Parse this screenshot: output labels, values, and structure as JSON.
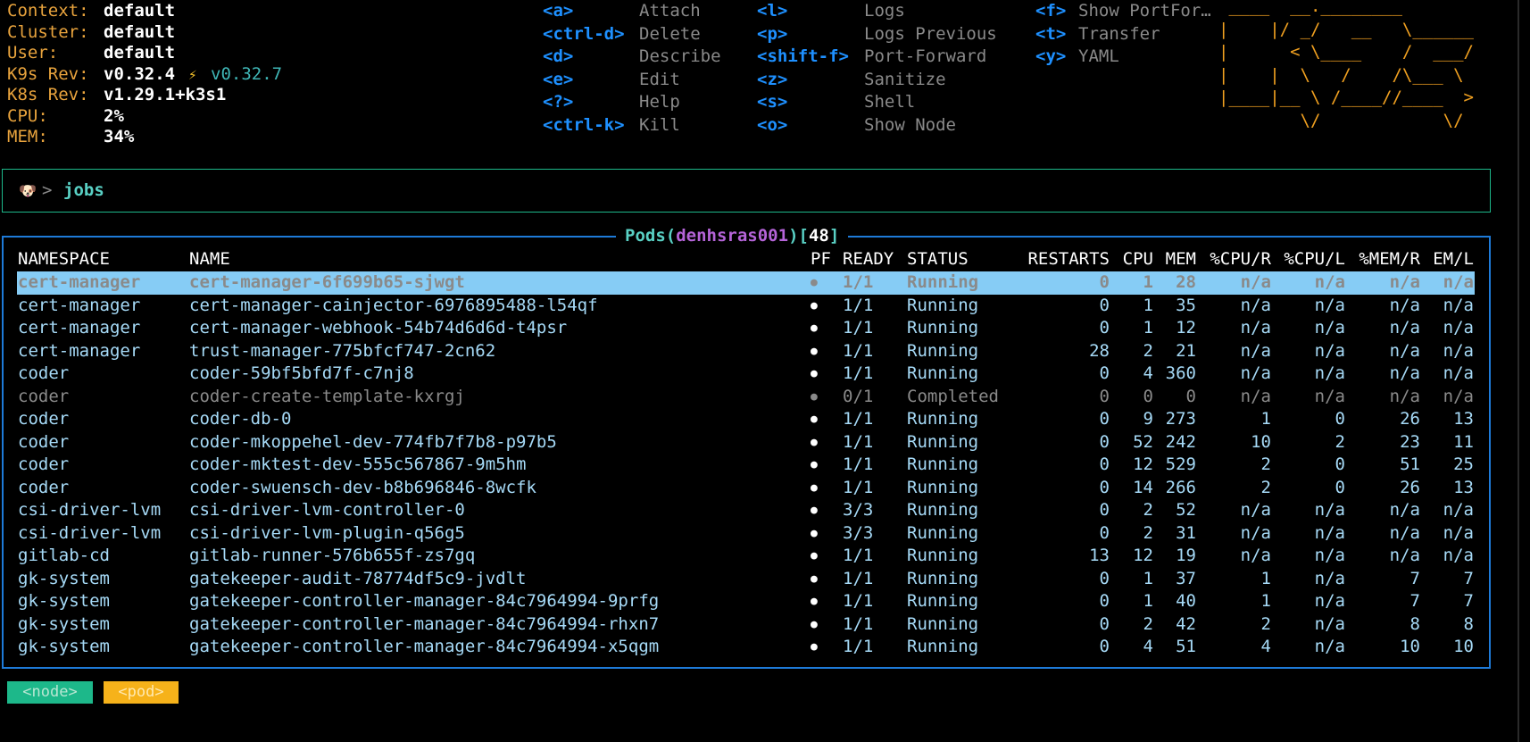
{
  "info": [
    {
      "label": "Context:",
      "value": "default"
    },
    {
      "label": "Cluster:",
      "value": "default"
    },
    {
      "label": "User:",
      "value": "default"
    },
    {
      "label": "K9s Rev:",
      "value": "v0.32.4",
      "update_icon": "⚡",
      "update": "v0.32.7"
    },
    {
      "label": "K8s Rev:",
      "value": "v1.29.1+k3s1"
    },
    {
      "label": "CPU:",
      "value": "2%"
    },
    {
      "label": "MEM:",
      "value": "34%"
    }
  ],
  "shortcuts": {
    "col1": [
      {
        "key": "<a>",
        "action": "Attach"
      },
      {
        "key": "<ctrl-d>",
        "action": "Delete"
      },
      {
        "key": "<d>",
        "action": "Describe"
      },
      {
        "key": "<e>",
        "action": "Edit"
      },
      {
        "key": "<?>",
        "action": "Help"
      },
      {
        "key": "<ctrl-k>",
        "action": "Kill"
      }
    ],
    "col2": [
      {
        "key": "<l>",
        "action": "Logs"
      },
      {
        "key": "<p>",
        "action": "Logs Previous"
      },
      {
        "key": "<shift-f>",
        "action": "Port-Forward"
      },
      {
        "key": "<z>",
        "action": "Sanitize"
      },
      {
        "key": "<s>",
        "action": "Shell"
      },
      {
        "key": "<o>",
        "action": "Show Node"
      }
    ],
    "col3": [
      {
        "key": "<f>",
        "action": "Show PortFor…"
      },
      {
        "key": "<t>",
        "action": "Transfer"
      },
      {
        "key": "<y>",
        "action": "YAML"
      }
    ]
  },
  "logo_lines": [
    " ____  __.________       ",
    "|    |/ _/   __   \\______",
    "|      < \\____    /  ___/",
    "|    |  \\   /    /\\___ \\ ",
    "|____|__ \\ /____//____  >",
    "        \\/            \\/ "
  ],
  "command": {
    "icon": "🐶",
    "prompt": ">",
    "text": "jobs"
  },
  "pods": {
    "title": "Pods",
    "context": "denhsras001",
    "count": "48",
    "headers": {
      "namespace": "NAMESPACE",
      "sort_arrow": "↑",
      "name": "NAME",
      "pf": "PF",
      "ready": "READY",
      "status": "STATUS",
      "restarts": "RESTARTS",
      "cpu": "CPU",
      "mem": "MEM",
      "cpu_r": "%CPU/R",
      "cpu_l": "%CPU/L",
      "mem_r": "%MEM/R",
      "mem_l": "EM/L"
    },
    "rows": [
      {
        "ns": "cert-manager",
        "name": "cert-manager-6f699b65-sjwgt",
        "pf": "●",
        "ready": "1/1",
        "status": "Running",
        "restarts": "0",
        "cpu": "1",
        "mem": "28",
        "cpu_r": "n/a",
        "cpu_l": "n/a",
        "mem_r": "n/a",
        "mem_l": "n/a",
        "selected": true
      },
      {
        "ns": "cert-manager",
        "name": "cert-manager-cainjector-6976895488-l54qf",
        "pf": "●",
        "ready": "1/1",
        "status": "Running",
        "restarts": "0",
        "cpu": "1",
        "mem": "35",
        "cpu_r": "n/a",
        "cpu_l": "n/a",
        "mem_r": "n/a",
        "mem_l": "n/a"
      },
      {
        "ns": "cert-manager",
        "name": "cert-manager-webhook-54b74d6d6d-t4psr",
        "pf": "●",
        "ready": "1/1",
        "status": "Running",
        "restarts": "0",
        "cpu": "1",
        "mem": "12",
        "cpu_r": "n/a",
        "cpu_l": "n/a",
        "mem_r": "n/a",
        "mem_l": "n/a"
      },
      {
        "ns": "cert-manager",
        "name": "trust-manager-775bfcf747-2cn62",
        "pf": "●",
        "ready": "1/1",
        "status": "Running",
        "restarts": "28",
        "cpu": "2",
        "mem": "21",
        "cpu_r": "n/a",
        "cpu_l": "n/a",
        "mem_r": "n/a",
        "mem_l": "n/a"
      },
      {
        "ns": "coder",
        "name": "coder-59bf5bfd7f-c7nj8",
        "pf": "●",
        "ready": "1/1",
        "status": "Running",
        "restarts": "0",
        "cpu": "4",
        "mem": "360",
        "cpu_r": "n/a",
        "cpu_l": "n/a",
        "mem_r": "n/a",
        "mem_l": "n/a"
      },
      {
        "ns": "coder",
        "name": "coder-create-template-kxrgj",
        "pf": "●",
        "ready": "0/1",
        "status": "Completed",
        "restarts": "0",
        "cpu": "0",
        "mem": "0",
        "cpu_r": "n/a",
        "cpu_l": "n/a",
        "mem_r": "n/a",
        "mem_l": "n/a",
        "dim": true
      },
      {
        "ns": "coder",
        "name": "coder-db-0",
        "pf": "●",
        "ready": "1/1",
        "status": "Running",
        "restarts": "0",
        "cpu": "9",
        "mem": "273",
        "cpu_r": "1",
        "cpu_l": "0",
        "mem_r": "26",
        "mem_l": "13"
      },
      {
        "ns": "coder",
        "name": "coder-mkoppehel-dev-774fb7f7b8-p97b5",
        "pf": "●",
        "ready": "1/1",
        "status": "Running",
        "restarts": "0",
        "cpu": "52",
        "mem": "242",
        "cpu_r": "10",
        "cpu_l": "2",
        "mem_r": "23",
        "mem_l": "11"
      },
      {
        "ns": "coder",
        "name": "coder-mktest-dev-555c567867-9m5hm",
        "pf": "●",
        "ready": "1/1",
        "status": "Running",
        "restarts": "0",
        "cpu": "12",
        "mem": "529",
        "cpu_r": "2",
        "cpu_l": "0",
        "mem_r": "51",
        "mem_l": "25"
      },
      {
        "ns": "coder",
        "name": "coder-swuensch-dev-b8b696846-8wcfk",
        "pf": "●",
        "ready": "1/1",
        "status": "Running",
        "restarts": "0",
        "cpu": "14",
        "mem": "266",
        "cpu_r": "2",
        "cpu_l": "0",
        "mem_r": "26",
        "mem_l": "13"
      },
      {
        "ns": "csi-driver-lvm",
        "name": "csi-driver-lvm-controller-0",
        "pf": "●",
        "ready": "3/3",
        "status": "Running",
        "restarts": "0",
        "cpu": "2",
        "mem": "52",
        "cpu_r": "n/a",
        "cpu_l": "n/a",
        "mem_r": "n/a",
        "mem_l": "n/a"
      },
      {
        "ns": "csi-driver-lvm",
        "name": "csi-driver-lvm-plugin-q56g5",
        "pf": "●",
        "ready": "3/3",
        "status": "Running",
        "restarts": "0",
        "cpu": "2",
        "mem": "31",
        "cpu_r": "n/a",
        "cpu_l": "n/a",
        "mem_r": "n/a",
        "mem_l": "n/a"
      },
      {
        "ns": "gitlab-cd",
        "name": "gitlab-runner-576b655f-zs7gq",
        "pf": "●",
        "ready": "1/1",
        "status": "Running",
        "restarts": "13",
        "cpu": "12",
        "mem": "19",
        "cpu_r": "n/a",
        "cpu_l": "n/a",
        "mem_r": "n/a",
        "mem_l": "n/a"
      },
      {
        "ns": "gk-system",
        "name": "gatekeeper-audit-78774df5c9-jvdlt",
        "pf": "●",
        "ready": "1/1",
        "status": "Running",
        "restarts": "0",
        "cpu": "1",
        "mem": "37",
        "cpu_r": "1",
        "cpu_l": "n/a",
        "mem_r": "7",
        "mem_l": "7"
      },
      {
        "ns": "gk-system",
        "name": "gatekeeper-controller-manager-84c7964994-9prfg",
        "pf": "●",
        "ready": "1/1",
        "status": "Running",
        "restarts": "0",
        "cpu": "1",
        "mem": "40",
        "cpu_r": "1",
        "cpu_l": "n/a",
        "mem_r": "7",
        "mem_l": "7"
      },
      {
        "ns": "gk-system",
        "name": "gatekeeper-controller-manager-84c7964994-rhxn7",
        "pf": "●",
        "ready": "1/1",
        "status": "Running",
        "restarts": "0",
        "cpu": "2",
        "mem": "42",
        "cpu_r": "2",
        "cpu_l": "n/a",
        "mem_r": "8",
        "mem_l": "8"
      },
      {
        "ns": "gk-system",
        "name": "gatekeeper-controller-manager-84c7964994-x5qgm",
        "pf": "●",
        "ready": "1/1",
        "status": "Running",
        "restarts": "0",
        "cpu": "4",
        "mem": "51",
        "cpu_r": "4",
        "cpu_l": "n/a",
        "mem_r": "10",
        "mem_l": "10"
      }
    ]
  },
  "breadcrumbs": {
    "node": "<node>",
    "pod": "<pod>"
  },
  "colors": {
    "background": "#000000",
    "label": "#e8a33d",
    "key": "#1e90ff",
    "row_text": "#a6daf7",
    "selected_bg": "#86ccf5",
    "frame": "#1e7ad8",
    "command_frame": "#1db88a",
    "logo": "#f0a020"
  }
}
